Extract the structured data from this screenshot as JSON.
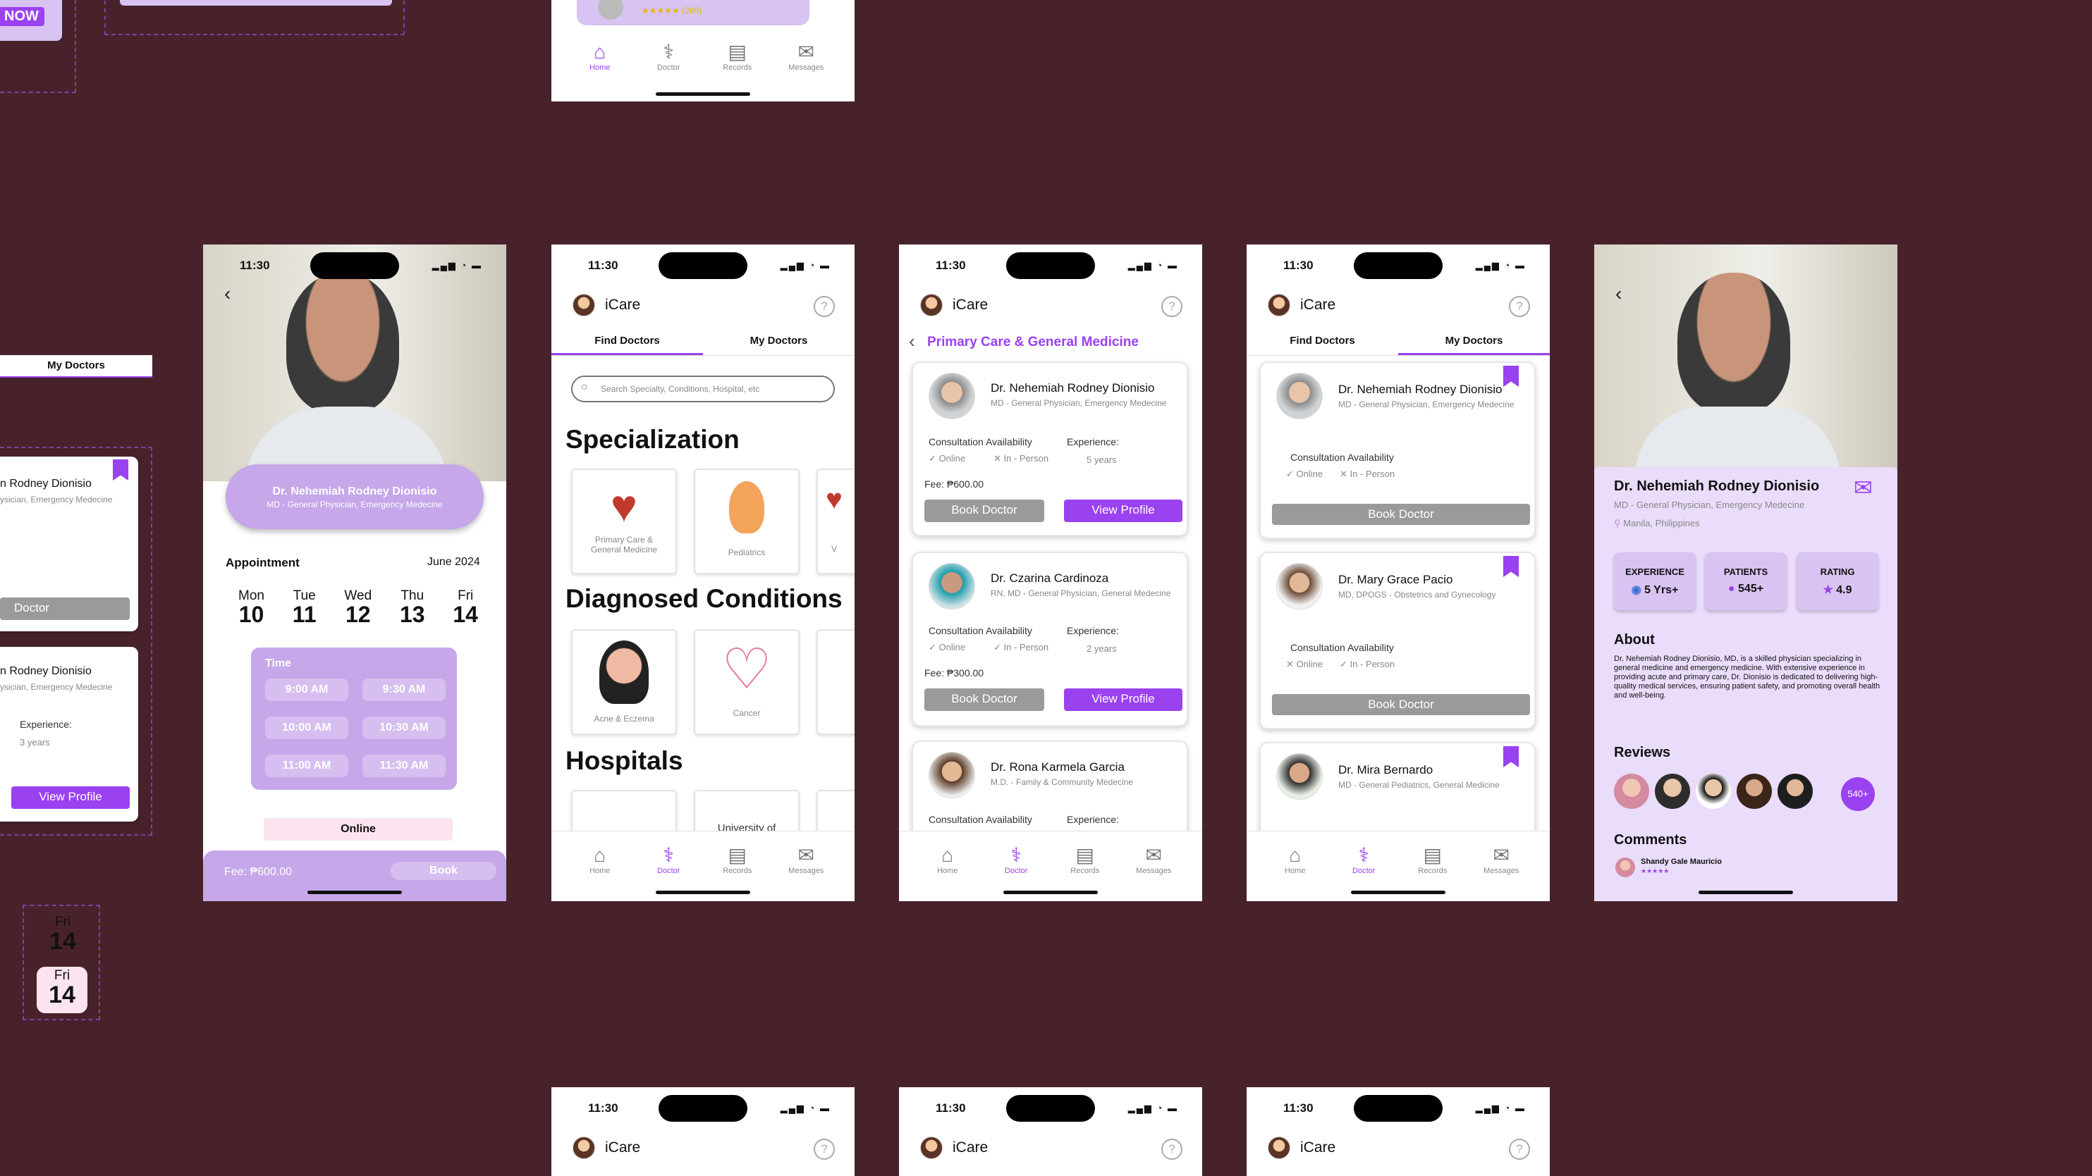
{
  "common": {
    "time": "11:30",
    "app_name": "iCare",
    "help": "?",
    "nav": [
      "Home",
      "Doctor",
      "Records",
      "Messages"
    ],
    "tab_find": "Find Doctors",
    "tab_my": "My Doctors"
  },
  "top_partial": {
    "badge": "NOW",
    "rating_count": "★★★★★ (280)"
  },
  "left_partial": {
    "tab": "My Doctors",
    "card1_name": "n Rodney Dionisio",
    "card1_spec": "ysician, Emergency Medecine",
    "card1_btn": "Doctor",
    "card2_name": "n Rodney Dionisio",
    "card2_spec": "ysician, Emergency Medecine",
    "exp_label": "Experience:",
    "exp_val": "3 years",
    "view_profile": "View Profile"
  },
  "day_widget": {
    "day": "Fri",
    "date": "14"
  },
  "screen1": {
    "name": "Dr. Nehemiah Rodney Dionisio",
    "spec": "MD - General Physician, Emergency Medecine",
    "appointment": "Appointment",
    "month": "June 2024",
    "days": [
      {
        "d": "Mon",
        "n": "10"
      },
      {
        "d": "Tue",
        "n": "11"
      },
      {
        "d": "Wed",
        "n": "12"
      },
      {
        "d": "Thu",
        "n": "13"
      },
      {
        "d": "Fri",
        "n": "14"
      }
    ],
    "time_label": "Time",
    "slots": [
      "9:00 AM",
      "9:30 AM",
      "10:00 AM",
      "10:30 AM",
      "11:00 AM",
      "11:30 AM"
    ],
    "mode": "Online",
    "fee": "Fee:  ₱600.00",
    "book": "Book"
  },
  "screen2": {
    "search_placeholder": "Search Specialty, Conditions, Hospital, etc",
    "specialization": "Specialization",
    "spec_tiles": [
      "Primary Care & General Medicine",
      "Pediatrics",
      "V"
    ],
    "diagnosed": "Diagnosed Conditions",
    "cond_tiles": [
      "Acne & Eczema",
      "Cancer"
    ],
    "hospitals": "Hospitals",
    "hospital_tile": "University of"
  },
  "screen3": {
    "title": "Primary Care & General Medicine",
    "consult": "Consultation Availability",
    "experience": "Experience:",
    "online": "Online",
    "inperson": "In - Person",
    "book": "Book Doctor",
    "view": "View Profile",
    "doctors": [
      {
        "name": "Dr. Nehemiah Rodney Dionisio",
        "spec": "MD - General Physician, Emergency Medecine",
        "years": "5 years",
        "fee": "Fee: ₱600.00"
      },
      {
        "name": "Dr. Czarina Cardinoza",
        "spec": "RN, MD - General Physician, General Medecine",
        "years": "2 years",
        "fee": "Fee: ₱300.00"
      },
      {
        "name": "Dr. Rona Karmela Garcia",
        "spec": "M.D. - Family & Community Medecine"
      }
    ]
  },
  "screen4": {
    "consult": "Consultation Availability",
    "online": "Online",
    "inperson": "In - Person",
    "book": "Book Doctor",
    "doctors": [
      {
        "name": "Dr. Nehemiah Rodney Dionisio",
        "spec": "MD - General Physician, Emergency Medecine"
      },
      {
        "name": "Dr. Mary Grace Pacio",
        "spec": "MD, DPOGS - Obstetrics and Gynecology"
      },
      {
        "name": "Dr. Mira Bernardo",
        "spec": "MD - General Pediatrics, General Medicine"
      }
    ]
  },
  "screen5": {
    "name": "Dr. Nehemiah Rodney Dionisio",
    "spec": "MD - General Physician, Emergency Medecine",
    "location": "Manila, Philippines",
    "stats": [
      {
        "l": "EXPERIENCE",
        "v": "5 Yrs+"
      },
      {
        "l": "PATIENTS",
        "v": "545+"
      },
      {
        "l": "RATING",
        "v": "4.9"
      }
    ],
    "about": "About",
    "about_text": "Dr. Nehemiah Rodney Dionisio, MD, is a skilled physician specializing in general medicine and emergency medicine. With extensive experience in providing acute and primary care, Dr. Dionisio is dedicated to delivering high-quality medical services, ensuring patient safety, and promoting overall health and well-being.",
    "reviews": "Reviews",
    "more": "540+",
    "comments": "Comments",
    "commenter": "Shandy Gale Mauricio",
    "stars": "★★★★★"
  }
}
